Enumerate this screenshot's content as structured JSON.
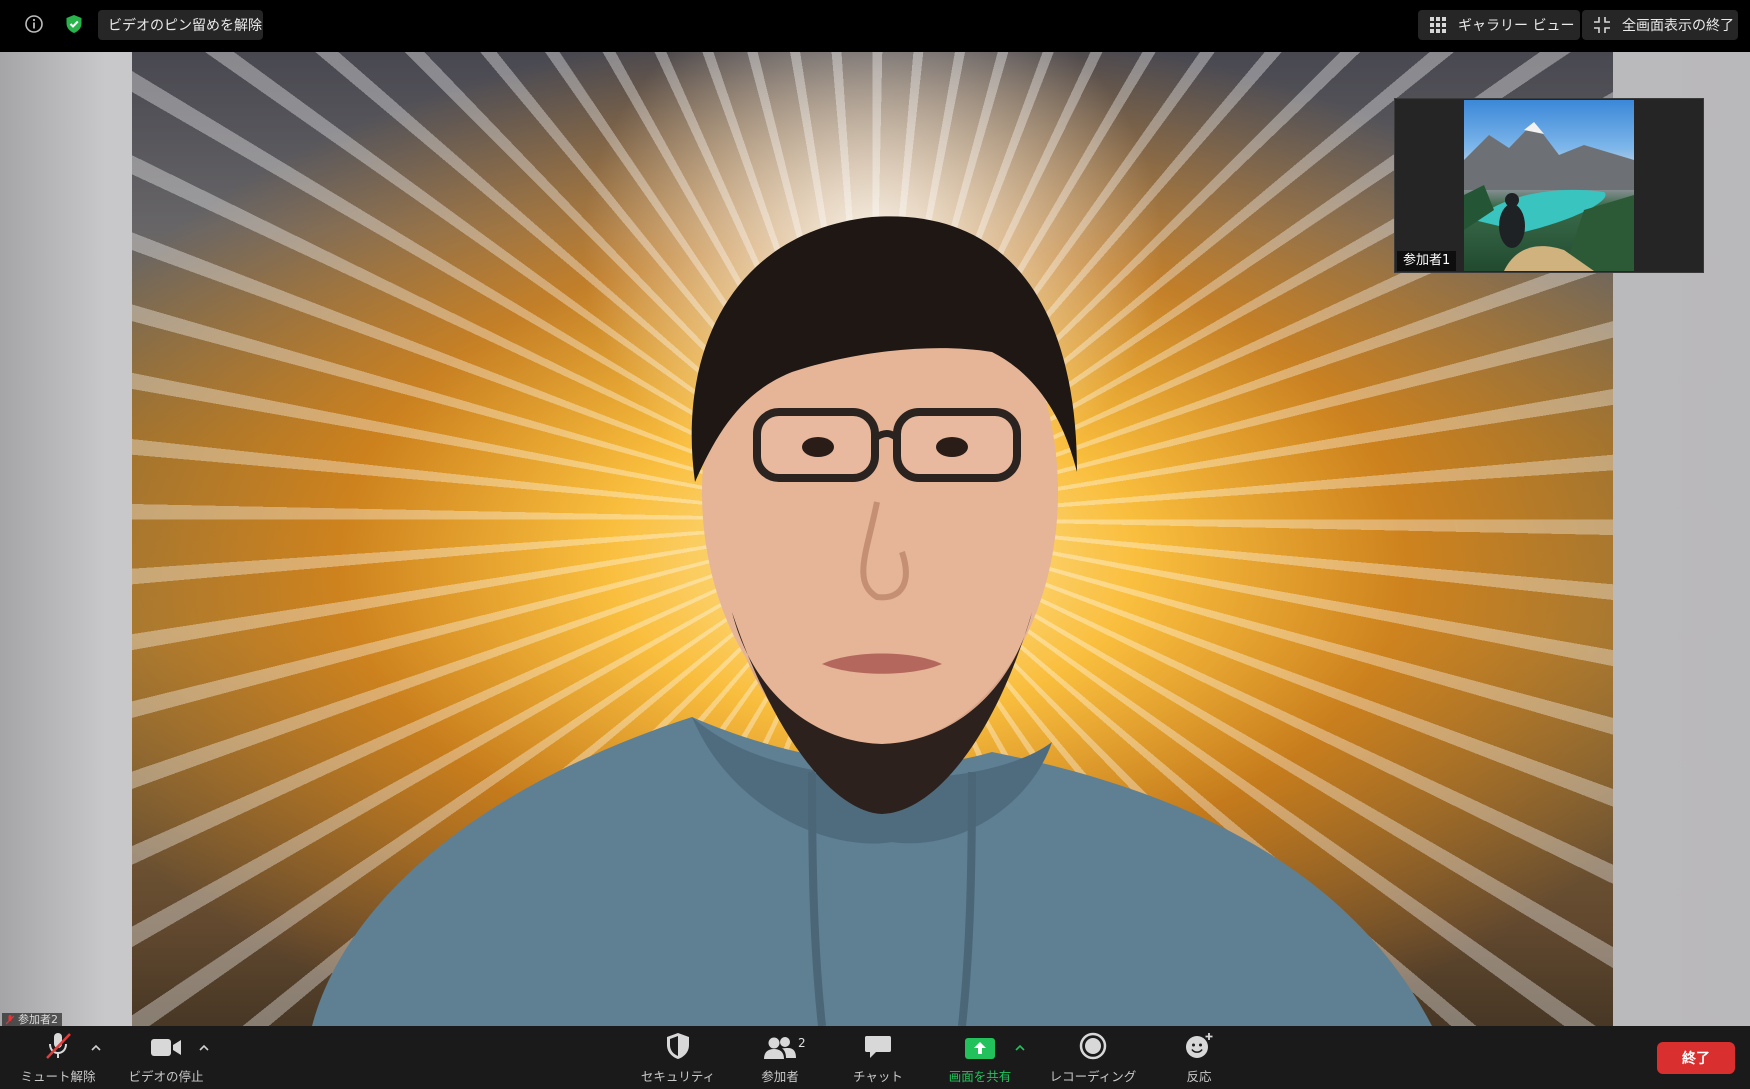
{
  "top_bar": {
    "unpin_label": "ビデオのピン留めを解除",
    "gallery_label": "ギャラリー ビュー",
    "exit_fullscreen_label": "全画面表示の終了"
  },
  "thumbnail": {
    "name": "参加者1"
  },
  "self_tag": {
    "name": "参加者2"
  },
  "toolbar": {
    "unmute_label": "ミュート解除",
    "stop_video_label": "ビデオの停止",
    "security_label": "セキュリティ",
    "participants_label": "参加者",
    "participants_count": "2",
    "chat_label": "チャット",
    "share_label": "画面を共有",
    "record_label": "レコーディング",
    "reactions_label": "反応",
    "end_label": "終了"
  },
  "colors": {
    "toolbar_bg": "#1a1a1a",
    "share_green": "#23c15c",
    "end_red": "#d92f2f",
    "security_green": "#28b34b"
  }
}
